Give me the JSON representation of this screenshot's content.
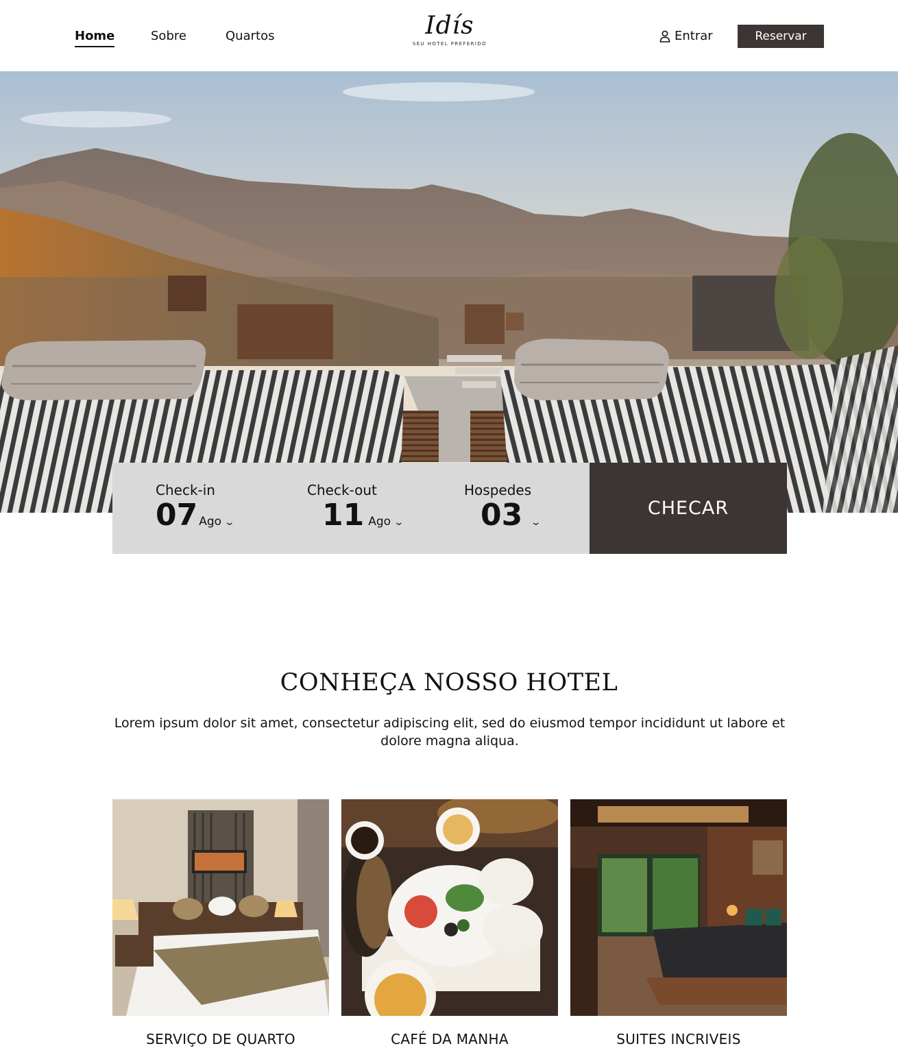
{
  "header": {
    "nav": [
      {
        "label": "Home",
        "active": true
      },
      {
        "label": "Sobre",
        "active": false
      },
      {
        "label": "Quartos",
        "active": false
      }
    ],
    "logo": {
      "name": "Idís",
      "tagline": "SEU HOTEL PREFERIDO"
    },
    "login_label": "Entrar",
    "login_icon": "user-icon",
    "book_label": "Reservar"
  },
  "booking": {
    "checkin": {
      "label": "Check-in",
      "day": "07",
      "month": "Ago"
    },
    "checkout": {
      "label": "Check-out",
      "day": "11",
      "month": "Ago"
    },
    "guests": {
      "label": "Hospedes",
      "count": "03"
    },
    "check_label": "CHECAR"
  },
  "about": {
    "title": "CONHEÇA NOSSO HOTEL",
    "text": "Lorem ipsum dolor sit amet, consectetur adipiscing elit, sed do eiusmod tempor incididunt ut labore et dolore magna aliqua."
  },
  "cards": [
    {
      "caption": "SERVIÇO DE QUARTO"
    },
    {
      "caption": "CAFÉ DA MANHA"
    },
    {
      "caption": "SUITES INCRIVEIS"
    }
  ],
  "colors": {
    "accent": "#3d3533",
    "booking_bg": "#d9d9d9"
  }
}
